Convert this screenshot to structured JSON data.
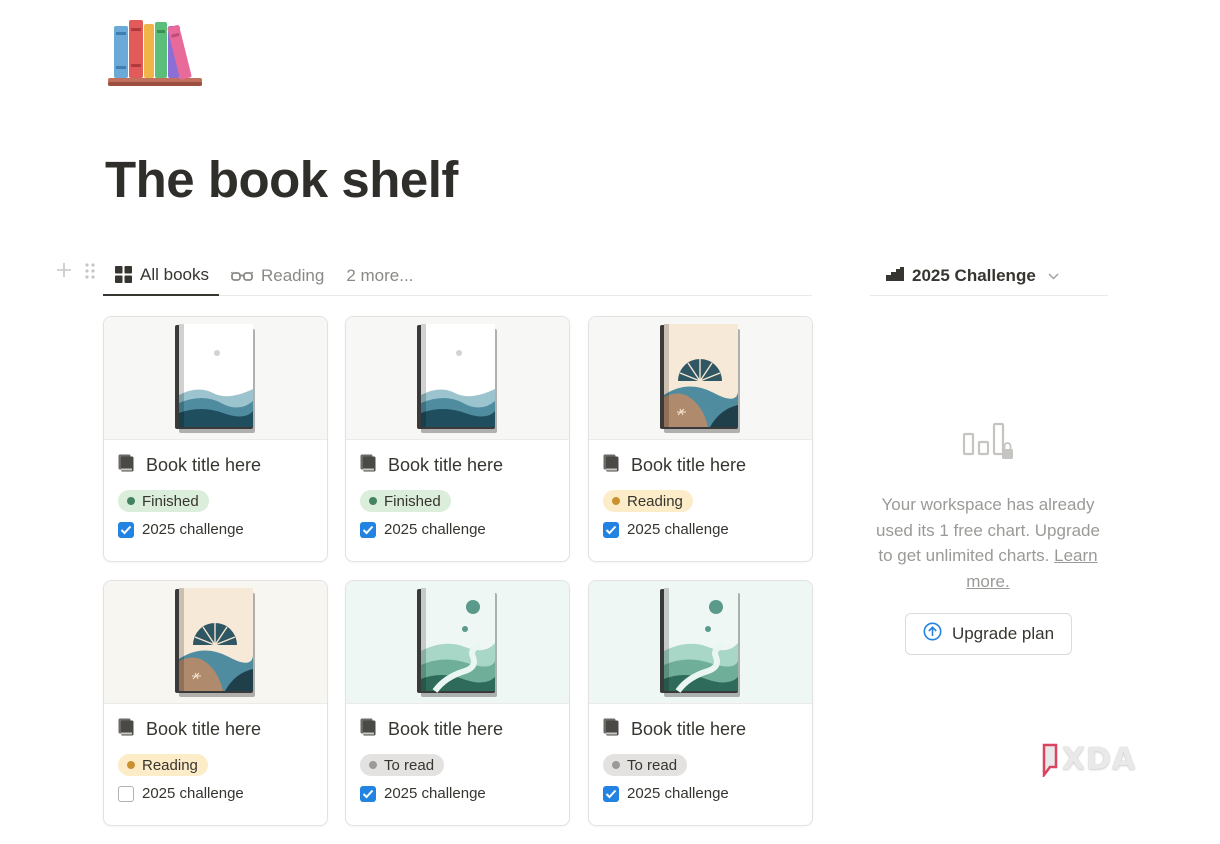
{
  "page": {
    "title": "The book shelf",
    "icon": "books-icon"
  },
  "tabs": [
    {
      "label": "All books",
      "icon": "gallery-grid-icon",
      "active": true
    },
    {
      "label": "Reading",
      "icon": "glasses-icon",
      "active": false
    },
    {
      "label": "2 more...",
      "icon": "",
      "active": false
    }
  ],
  "chart_view": {
    "title": "2025 Challenge",
    "icon": "bar-chart-icon",
    "message": "Your workspace has already used its 1 free chart. Upgrade to get unlimited charts.",
    "link": "Learn more.",
    "button": "Upgrade plan",
    "button_icon": "arrow-up-circle-icon"
  },
  "cards": [
    {
      "title": "Book title here",
      "status": "Finished",
      "status_color": "#448361",
      "status_bg": "#dbeddb",
      "challenge_label": "2025 challenge",
      "challenge_checked": true,
      "cover": "waves",
      "cover_bg": "#f7f7f5"
    },
    {
      "title": "Book title here",
      "status": "Finished",
      "status_color": "#448361",
      "status_bg": "#dbeddb",
      "challenge_label": "2025 challenge",
      "challenge_checked": true,
      "cover": "waves",
      "cover_bg": "#f7f7f5"
    },
    {
      "title": "Book title here",
      "status": "Reading",
      "status_color": "#cb912f",
      "status_bg": "#fdecc8",
      "challenge_label": "2025 challenge",
      "challenge_checked": true,
      "cover": "shell",
      "cover_bg": "#f7f7f5"
    },
    {
      "title": "Book title here",
      "status": "Reading",
      "status_color": "#cb912f",
      "status_bg": "#fdecc8",
      "challenge_label": "2025 challenge",
      "challenge_checked": false,
      "cover": "shell",
      "cover_bg": "#f7f6f0"
    },
    {
      "title": "Book title here",
      "status": "To read",
      "status_color": "#9b9a97",
      "status_bg": "#e3e2e0",
      "challenge_label": "2025 challenge",
      "challenge_checked": true,
      "cover": "river",
      "cover_bg": "#eef7f3"
    },
    {
      "title": "Book title here",
      "status": "To read",
      "status_color": "#9b9a97",
      "status_bg": "#e3e2e0",
      "challenge_label": "2025 challenge",
      "challenge_checked": true,
      "cover": "river",
      "cover_bg": "#eef7f3"
    }
  ],
  "watermark": "XDA",
  "colors": {
    "accent": "#2383e2",
    "text": "#37352f",
    "muted": "#9b9a97"
  }
}
